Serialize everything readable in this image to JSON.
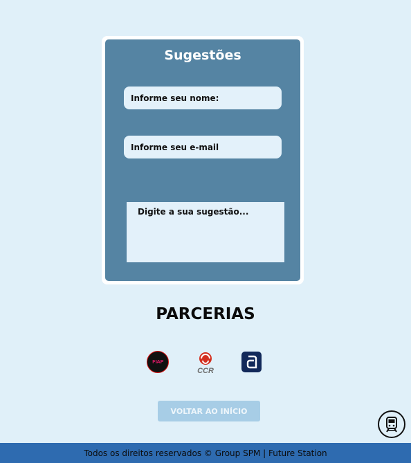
{
  "form": {
    "title": "Sugestões",
    "name_placeholder": "Informe seu nome:",
    "email_placeholder": "Informe seu e-mail",
    "message_placeholder": "Digite a sua sugestão..."
  },
  "partners": {
    "title": "PARCERIAS",
    "logos": [
      {
        "name": "FIAP",
        "text": "FIAP"
      },
      {
        "name": "CCR",
        "text": "CCR"
      },
      {
        "name": "app",
        "text": "a"
      }
    ]
  },
  "back_button": {
    "label": "VOLTAR AO INÍCIO"
  },
  "footer": {
    "text": "Todos os direitos reservados © Group SPM | Future Station"
  },
  "colors": {
    "background": "#e0f0f9",
    "card": "#5584a3",
    "field": "#e3f1fa",
    "button": "#a7cde6",
    "footer": "#2e6bb0"
  }
}
